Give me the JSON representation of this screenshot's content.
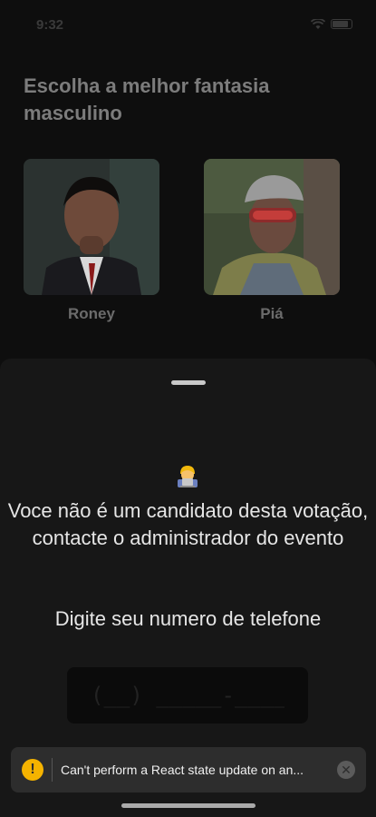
{
  "status_bar": {
    "time": "9:32"
  },
  "screen": {
    "title": "Escolha a melhor fantasia masculino"
  },
  "candidates": [
    {
      "name": "Roney",
      "photo_icon": "person-photo"
    },
    {
      "name": "Piá",
      "photo_icon": "person-photo"
    }
  ],
  "sheet": {
    "message": "Voce não é um candidato desta votação, contacte o administrador do evento",
    "emoji": "technologist-emoji",
    "phone_label": "Digite seu numero de telefone",
    "phone_placeholder": "(__) _____-_____"
  },
  "toast": {
    "text": "Can't perform a React state update on an...",
    "accent": "#f5b300"
  }
}
